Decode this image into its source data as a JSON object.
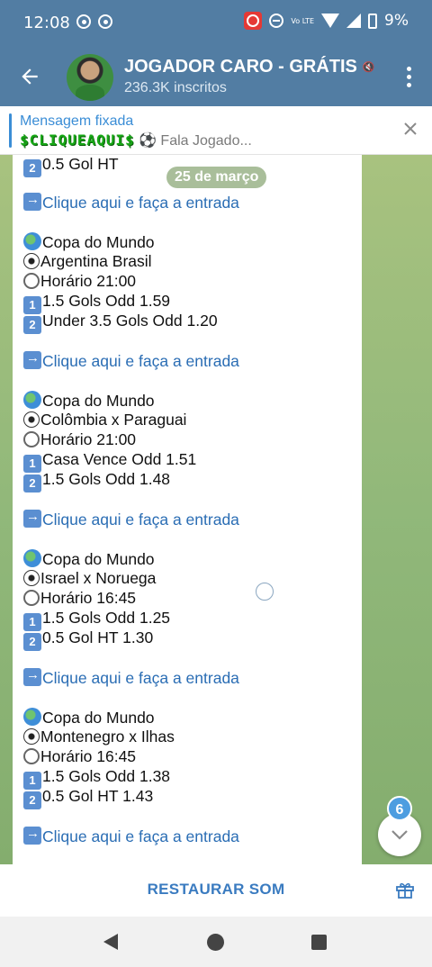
{
  "status_bar": {
    "time": "12:08",
    "network": "Vo LTE",
    "battery": "9%"
  },
  "app_bar": {
    "title": "JOGADOR CARO - GRÁTIS",
    "subscribers": "236.3K inscritos",
    "back_icon": "arrow-left-icon",
    "menu_icon": "more-vert-icon",
    "accent": "#527da3"
  },
  "pinned": {
    "label": "Mensagem fixada",
    "highlight": "$CLIQUEAQUI$",
    "preview": "⚽ Fala Jogado..."
  },
  "chat": {
    "date": "25 de março",
    "lines": [
      {
        "icon": "num2",
        "text": "0.5 Gol HT"
      },
      {
        "icon": "arrow",
        "text": "Clique aqui e faça a entrada",
        "link": true
      },
      {
        "icon": "globe",
        "text": "Copa do Mundo"
      },
      {
        "icon": "ball",
        "text": "Argentina Brasil"
      },
      {
        "icon": "clock",
        "text": "Horário 21:00"
      },
      {
        "icon": "num1",
        "text": "1.5 Gols Odd 1.59"
      },
      {
        "icon": "num2",
        "text": "Under 3.5 Gols Odd 1.20"
      },
      {
        "icon": "arrow",
        "text": "Clique aqui e faça a entrada",
        "link": true
      },
      {
        "icon": "globe",
        "text": "Copa do Mundo"
      },
      {
        "icon": "ball",
        "text": "Colômbia x Paraguai"
      },
      {
        "icon": "clock",
        "text": "Horário 21:00"
      },
      {
        "icon": "num1",
        "text": "Casa Vence Odd 1.51"
      },
      {
        "icon": "num2",
        "text": "1.5 Gols Odd 1.48"
      },
      {
        "icon": "arrow",
        "text": "Clique aqui e faça a entrada",
        "link": true
      },
      {
        "icon": "globe",
        "text": "Copa do Mundo"
      },
      {
        "icon": "ball",
        "text": "Israel x Noruega"
      },
      {
        "icon": "clock",
        "text": "Horário 16:45"
      },
      {
        "icon": "num1",
        "text": "1.5 Gols Odd 1.25"
      },
      {
        "icon": "num2",
        "text": "0.5 Gol HT 1.30"
      },
      {
        "icon": "arrow",
        "text": "Clique aqui e faça a entrada",
        "link": true
      },
      {
        "icon": "globe",
        "text": "Copa do Mundo"
      },
      {
        "icon": "ball",
        "text": "Montenegro x Ilhas"
      },
      {
        "icon": "clock",
        "text": "Horário 16:45"
      },
      {
        "icon": "num1",
        "text": "1.5 Gols Odd 1.38"
      },
      {
        "icon": "num2",
        "text": "0.5 Gol HT 1.43"
      },
      {
        "icon": "arrow",
        "text": "Clique aqui e faça a entrada",
        "link": true
      }
    ],
    "unread_count": "6"
  },
  "bottom": {
    "restore_label": "RESTAURAR SOM",
    "gift_icon": "gift-icon"
  }
}
